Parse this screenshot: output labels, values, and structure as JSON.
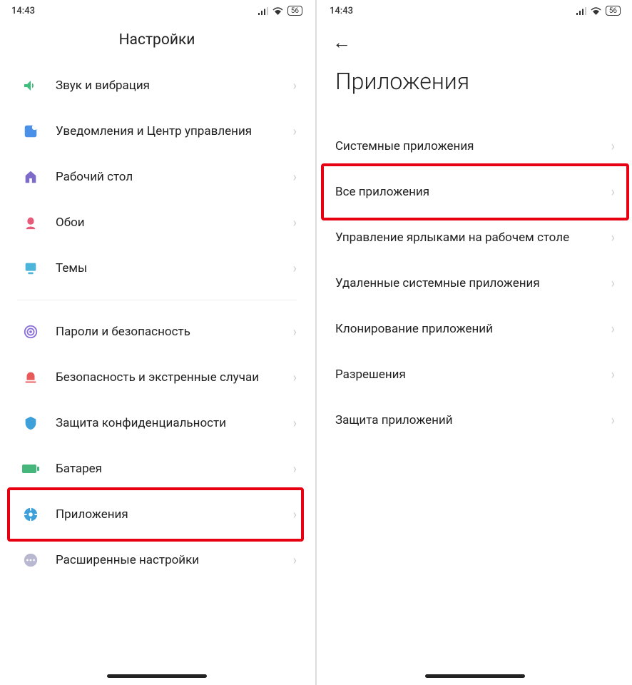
{
  "status": {
    "time": "14:43",
    "battery": "56"
  },
  "left": {
    "title": "Настройки",
    "items": [
      {
        "label": "Звук и вибрация",
        "icon": "sound",
        "color": "#3cbf7a"
      },
      {
        "label": "Уведомления и Центр управления",
        "icon": "notification",
        "color": "#4a8fe8"
      },
      {
        "label": "Рабочий стол",
        "icon": "home",
        "color": "#7e6bc9"
      },
      {
        "label": "Обои",
        "icon": "wallpaper",
        "color": "#e85a7a"
      },
      {
        "label": "Темы",
        "icon": "theme",
        "color": "#4cb5d9"
      }
    ],
    "items2": [
      {
        "label": "Пароли и безопасность",
        "icon": "fingerprint",
        "color": "#8a6fd8"
      },
      {
        "label": "Безопасность и экстренные случаи",
        "icon": "emergency",
        "color": "#e85a5a"
      },
      {
        "label": "Защита конфиденциальности",
        "icon": "shield",
        "color": "#3da0d9"
      },
      {
        "label": "Батарея",
        "icon": "battery",
        "color": "#46b77a"
      },
      {
        "label": "Приложения",
        "icon": "apps",
        "color": "#3da0d9",
        "highlighted": true
      },
      {
        "label": "Расширенные настройки",
        "icon": "more",
        "color": "#b8b8d1"
      }
    ]
  },
  "right": {
    "title": "Приложения",
    "items": [
      {
        "label": "Системные приложения"
      },
      {
        "label": "Все приложения",
        "highlighted": true
      },
      {
        "label": "Управление ярлыками на рабочем столе"
      },
      {
        "label": "Удаленные системные приложения"
      },
      {
        "label": "Клонирование приложений"
      },
      {
        "label": "Разрешения"
      },
      {
        "label": "Защита приложений"
      }
    ]
  }
}
